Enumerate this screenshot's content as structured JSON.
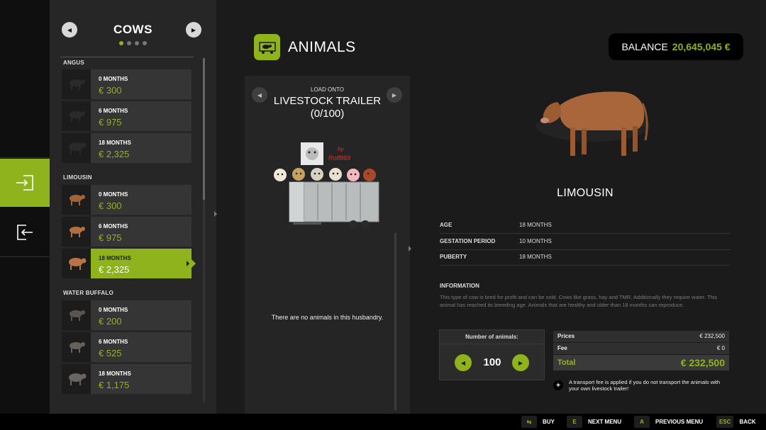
{
  "navigation": {
    "items": [
      {
        "id": "buy",
        "icon": "enter-icon"
      },
      {
        "id": "sell",
        "icon": "exit-icon"
      }
    ]
  },
  "category": {
    "title": "COWS",
    "page_dots": 4,
    "active_dot": 0,
    "sections": [
      {
        "label": "ANGUS",
        "items": [
          {
            "age": "0 MONTHS",
            "price": "€ 300"
          },
          {
            "age": "6 MONTHS",
            "price": "€ 975"
          },
          {
            "age": "18 MONTHS",
            "price": "€ 2,325"
          }
        ]
      },
      {
        "label": "LIMOUSIN",
        "items": [
          {
            "age": "0 MONTHS",
            "price": "€ 300"
          },
          {
            "age": "6 MONTHS",
            "price": "€ 975"
          },
          {
            "age": "18 MONTHS",
            "price": "€ 2,325",
            "selected": true
          }
        ]
      },
      {
        "label": "WATER BUFFALO",
        "items": [
          {
            "age": "0 MONTHS",
            "price": "€ 200"
          },
          {
            "age": "6 MONTHS",
            "price": "€ 525"
          },
          {
            "age": "18 MONTHS",
            "price": "€ 1,175"
          }
        ]
      }
    ]
  },
  "header": {
    "title": "ANIMALS",
    "icon": "animals-icon"
  },
  "balance": {
    "label": "BALANCE",
    "value": "20,645,045 €"
  },
  "trailer": {
    "load_label": "LOAD ONTO",
    "title_line1": "LIVESTOCK TRAILER",
    "title_line2": "(0/100)",
    "empty_message": "There are no animals in this husbandry.",
    "image_caption_1": "by",
    "image_caption_2": "Rolf869"
  },
  "animal": {
    "name": "LIMOUSIN",
    "details": [
      {
        "key": "AGE",
        "value": "18 MONTHS"
      },
      {
        "key": "GESTATION PERIOD",
        "value": "10 MONTHS"
      },
      {
        "key": "PUBERTY",
        "value": "18 MONTHS"
      }
    ],
    "info_heading": "INFORMATION",
    "info_text": "This type of cow is bred for profit and can be sold. Cows like grass, hay and TMR. Additionally they require water. This animal has reached its breeding age. Animals that are healthy and older than 18 months can reproduce."
  },
  "purchase": {
    "count_label": "Number of animals:",
    "count": "100",
    "prices_label": "Prices",
    "prices_value": "€ 232,500",
    "fee_label": "Fee",
    "fee_value": "€ 0",
    "total_label": "Total",
    "total_value": "€ 232,500",
    "note": "A transport fee is applied if you do not transport the animals with your own livestock trailer!"
  },
  "footer": {
    "buy": {
      "key": "⇆",
      "label": "BUY"
    },
    "next": {
      "key": "E",
      "label": "NEXT MENU"
    },
    "prev": {
      "key": "A",
      "label": "PREVIOUS MENU"
    },
    "back": {
      "key": "ESC",
      "label": "BACK"
    }
  },
  "colors": {
    "accent": "#8fb31d",
    "background": "#1b1b1b",
    "panel": "#262626"
  }
}
